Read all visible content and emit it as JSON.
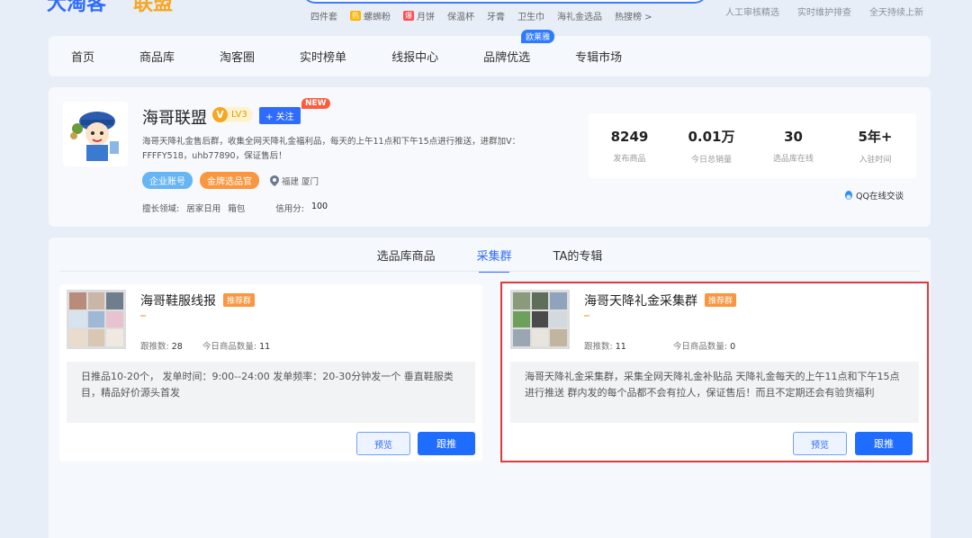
{
  "header": {
    "logo_left": "大淘客",
    "logo_right": "联盟",
    "hot_words": [
      {
        "label": "四件套",
        "badge": ""
      },
      {
        "label": "螺蛳粉",
        "badge": "热"
      },
      {
        "label": "月饼",
        "badge": "爆"
      },
      {
        "label": "保温杯",
        "badge": ""
      },
      {
        "label": "牙膏",
        "badge": ""
      },
      {
        "label": "卫生巾",
        "badge": ""
      },
      {
        "label": "海礼金选品",
        "badge": ""
      },
      {
        "label": "热搜榜 >",
        "badge": ""
      }
    ],
    "service_notes": [
      "人工审核精选",
      "实时维护排查",
      "全天持续上新"
    ]
  },
  "nav": {
    "items": [
      "首页",
      "商品库",
      "淘客圈",
      "实时榜单",
      "线报中心",
      "品牌优选",
      "专辑市场"
    ],
    "brand_badge": "欧莱雅"
  },
  "profile": {
    "name": "海哥联盟",
    "level": "LV3",
    "level_icon": "V",
    "follow_label": "+ 关注",
    "new_tag": "NEW",
    "description": "海哥天降礼金售后群，收集全网天降礼金福利品，每天的上午11点和下午15点进行推送，进群加V：FFFFY518，uhb77890，保证售后！",
    "tags": [
      "企业账号",
      "金牌选品官"
    ],
    "location": "福建 厦门",
    "skill_label": "擅长领域:",
    "skills": [
      "居家日用",
      "箱包"
    ],
    "credit_label": "信用分:",
    "credit_value": "100",
    "stats": [
      {
        "value": "8249",
        "label": "发布商品"
      },
      {
        "value": "0.01万",
        "label": "今日总销量"
      },
      {
        "value": "30",
        "label": "选品库在线"
      },
      {
        "value": "5年+",
        "label": "入驻时间"
      }
    ],
    "qq_label": "QQ在线交谈"
  },
  "tabs": {
    "items": [
      "选品库商品",
      "采集群",
      "TA的专辑"
    ],
    "active_index": 1
  },
  "groups": [
    {
      "title": "海哥鞋服线报",
      "tag": "推荐群",
      "follow_count_label": "跟推数:",
      "follow_count": "28",
      "today_label": "今日商品数量:",
      "today_count": "11",
      "description": "日推品10-20个， 发单时间：9:00--24:00 发单频率：20-30分钟发一个 垂直鞋服类目，精品好价源头首发",
      "preview_label": "预览",
      "follow_label": "跟推"
    },
    {
      "title": "海哥天降礼金采集群",
      "tag": "推荐群",
      "follow_count_label": "跟推数:",
      "follow_count": "11",
      "today_label": "今日商品数量:",
      "today_count": "0",
      "description": "海哥天降礼金采集群，采集全网天降礼金补贴品 天降礼金每天的上午11点和下午15点进行推送 群内发的每个品都不会有拉人，保证售后！而且不定期还会有验货福利",
      "preview_label": "预览",
      "follow_label": "跟推"
    }
  ],
  "colors": {
    "accent": "#2f6bff",
    "highlight_border": "#e23a3a",
    "orange_tag": "#f9963f"
  }
}
